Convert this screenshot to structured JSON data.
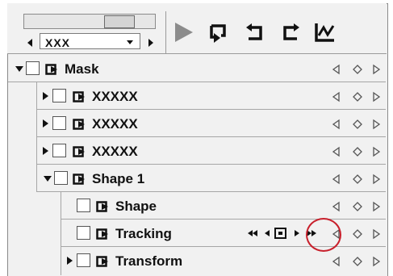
{
  "toolbar": {
    "combo_value": "XXX",
    "icons": [
      "play-icon",
      "loop-icon",
      "return-icon",
      "forward-icon",
      "graph-icon"
    ]
  },
  "rows": [
    {
      "label": "Mask",
      "expanded": true,
      "indent": 0
    },
    {
      "label": "XXXXX",
      "expanded": false,
      "indent": 1
    },
    {
      "label": "XXXXX",
      "expanded": false,
      "indent": 1
    },
    {
      "label": "XXXXX",
      "expanded": false,
      "indent": 1
    },
    {
      "label": "Shape 1",
      "expanded": true,
      "indent": 1
    },
    {
      "label": "Shape",
      "expanded": null,
      "indent": 2
    },
    {
      "label": "Tracking",
      "expanded": null,
      "indent": 2
    },
    {
      "label": "Transform",
      "expanded": false,
      "indent": 2
    }
  ],
  "colors": {
    "highlight": "#c8202c",
    "panel": "#f1f1f1"
  }
}
